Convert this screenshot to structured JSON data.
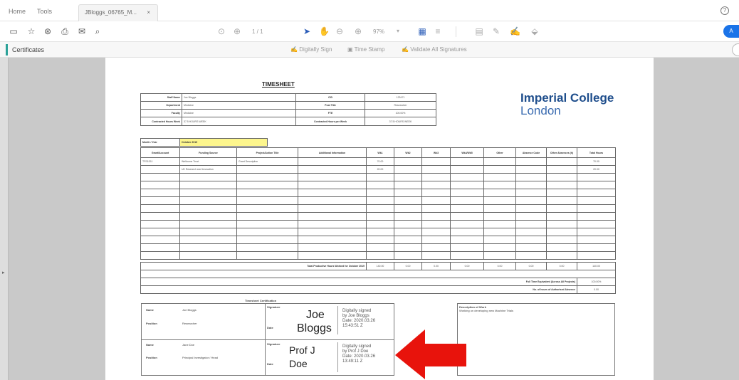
{
  "tabs": {
    "home": "Home",
    "tools": "Tools",
    "document": "JBloggs_06765_M...",
    "close": "×"
  },
  "toolbar": {
    "page_nav": "1 / 1",
    "zoom": "97%",
    "share": "A"
  },
  "certbar": {
    "label": "Certificates",
    "digitally_sign": "Digitally Sign",
    "time_stamp": "Time Stamp",
    "validate": "Validate All Signatures"
  },
  "document": {
    "title": "TIMESHEET",
    "logo_line1": "Imperial College",
    "logo_line2": "London",
    "info": {
      "rows": [
        [
          "Staff Name",
          "Joe Bloggs",
          "CID",
          "123471"
        ],
        [
          "Department",
          "Medicine",
          "Post Title",
          "Researcher"
        ],
        [
          "Faculty",
          "Medicine",
          "FTE",
          "100.00%"
        ],
        [
          "Contracted Hours Week",
          "37.5 HOURS WEEK",
          "Contracted Hours per Week",
          "37.5 HOURS WEEK"
        ]
      ]
    },
    "month_label": "Month / Year",
    "month_value": "October 2019",
    "columns": [
      "Grant/Account",
      "Funding Source",
      "Project/Action Title",
      "Additional Information",
      "Wk1",
      "Wk2",
      "Wk3",
      "Wk4/Wk5",
      "Other",
      "Absence Code",
      "Other Absences (h)",
      "Total Hours"
    ],
    "rows": [
      [
        "TFS1S11",
        "Wellcome Trust",
        "Grant Description",
        "",
        "70.00",
        "",
        "",
        "",
        "",
        "",
        "",
        "70.00"
      ],
      [
        "",
        "UK Research and Innovation",
        "",
        "",
        "20.00",
        "",
        "",
        "",
        "",
        "",
        "",
        "20.00"
      ]
    ],
    "total_label": "Total Productive Hours Worked for October 2019",
    "totals": [
      "140.00",
      "0.00",
      "0.00",
      "0.00",
      "0.00",
      "0.00",
      "0.00",
      "140.00"
    ],
    "fte_label": "Full Time Equivalent (Across All Projects)",
    "fte_value": "100.00%",
    "absence_label": "No. of hours of Authorised Absence",
    "absence_value": "0.00",
    "cert_title": "Timesheet Certification",
    "employee": {
      "name_label": "Name",
      "name": "Joe Bloggs",
      "position_label": "Position",
      "position": "Researcher",
      "sig_label": "Signature",
      "date_label": "Date"
    },
    "signer1": {
      "line1": "Joe",
      "line2": "Bloggs",
      "info": [
        "Digitally signed",
        "by Joe Bloggs",
        "Date: 2020.03.26",
        "15:43:51 Z"
      ]
    },
    "pi": {
      "name_label": "Name",
      "name": "Jane Doe",
      "position_label": "Position",
      "position": "Principal Investigator / Head",
      "sig_label": "Signature",
      "date_label": "Date"
    },
    "signer2": {
      "line1": "Prof J",
      "line2": "Doe",
      "info": [
        "Digitally signed",
        "by Prof J Doe",
        "Date: 2020.03.26",
        "13:49:11 Z"
      ]
    },
    "description_title": "Description of Work",
    "description_text": "Working on developing new Machine Trials"
  },
  "annotation": {
    "color": "#e8130c"
  }
}
